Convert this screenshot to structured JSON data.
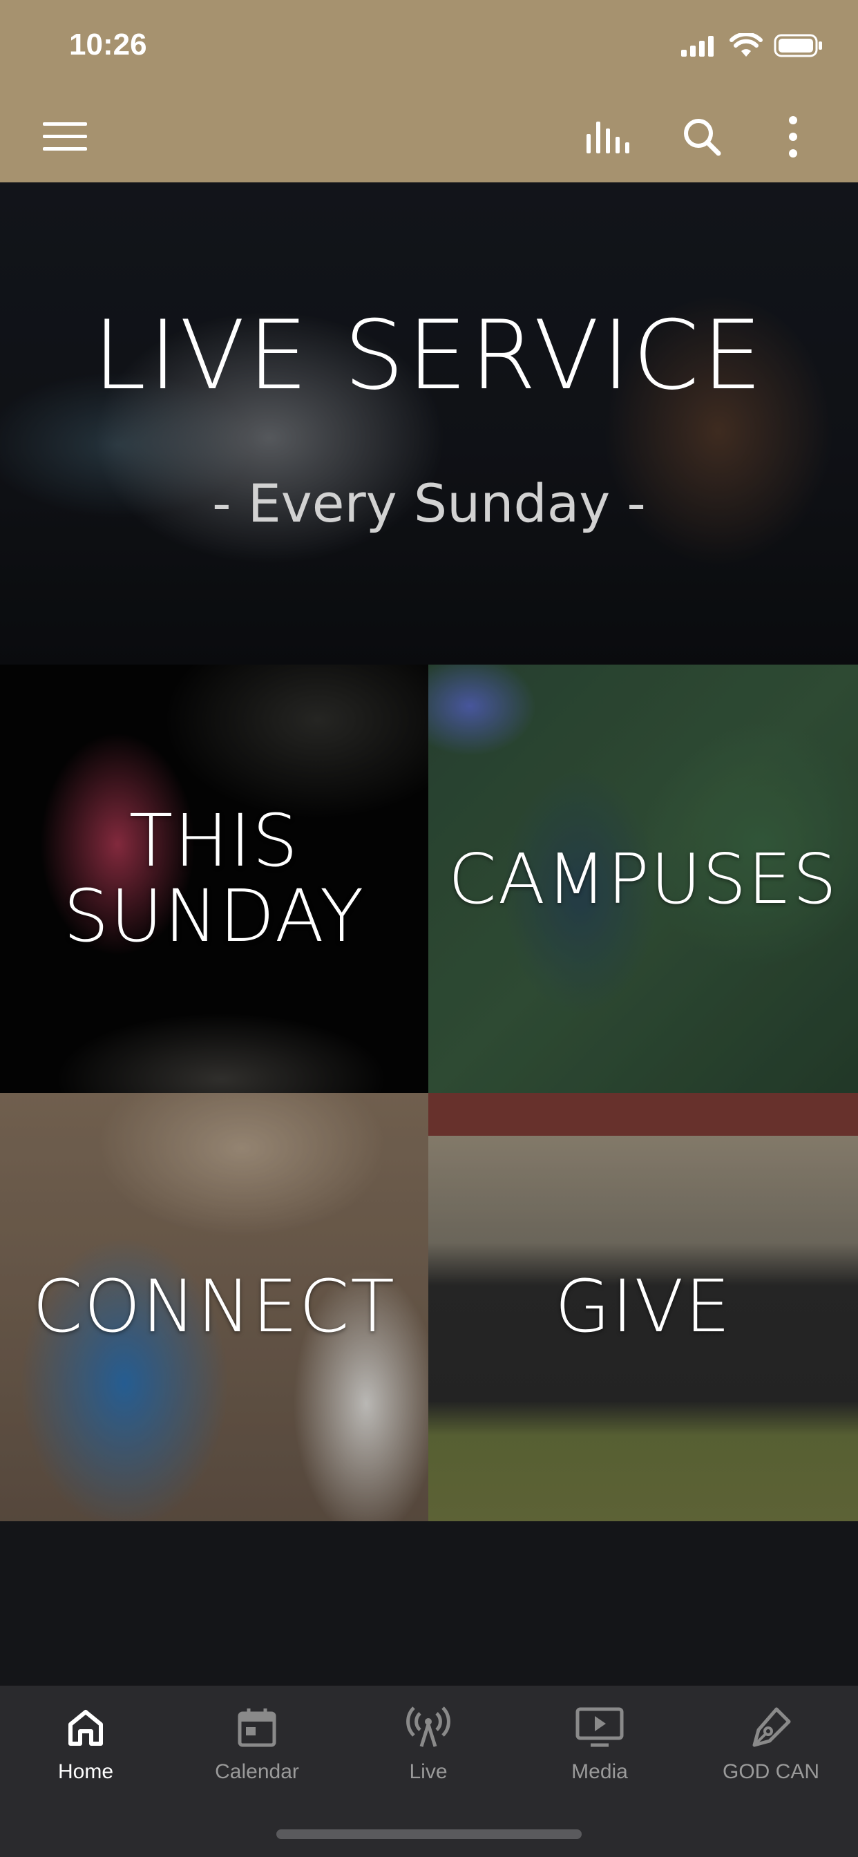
{
  "status_bar": {
    "time": "10:26"
  },
  "header": {
    "menu_icon": "hamburger-icon",
    "actions": [
      "audio-bars-icon",
      "search-icon",
      "more-vertical-icon"
    ],
    "background_color": "#a6926f"
  },
  "hero": {
    "title": "LIVE SERVICE",
    "subtitle": "- Every Sunday -"
  },
  "tiles": {
    "this_sunday": {
      "line1": "THIS",
      "line2": "SUNDAY"
    },
    "campuses": {
      "label": "CAMPUSES"
    },
    "connect": {
      "label": "CONNECT"
    },
    "give": {
      "label": "GIVE"
    }
  },
  "bottom_nav": {
    "items": [
      {
        "label": "Home",
        "icon": "home-icon",
        "active": true
      },
      {
        "label": "Calendar",
        "icon": "calendar-icon",
        "active": false
      },
      {
        "label": "Live",
        "icon": "broadcast-icon",
        "active": false
      },
      {
        "label": "Media",
        "icon": "media-play-icon",
        "active": false
      },
      {
        "label": "GOD CAN",
        "icon": "pen-icon",
        "active": false
      }
    ]
  }
}
